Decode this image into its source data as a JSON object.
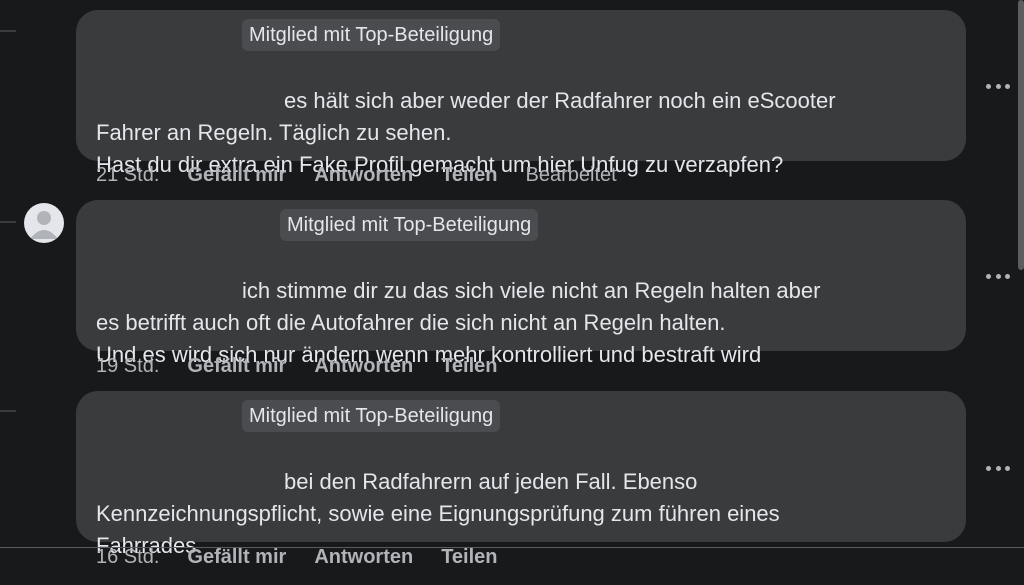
{
  "comments": [
    {
      "badge": "Mitglied mit Top-Beteiligung",
      "text": "es hält sich aber weder der Radfahrer noch ein eScooter\nFahrer an Regeln. Täglich zu sehen.\nHast du dir extra ein Fake Profil gemacht um hier Unfug zu verzapfen?",
      "time": "21 Std.",
      "like": "Gefällt mir",
      "reply": "Antworten",
      "share": "Teilen",
      "edited": "Bearbeitet"
    },
    {
      "badge": "Mitglied mit Top-Beteiligung",
      "text": "ich stimme dir zu das sich viele nicht an Regeln halten aber\nes betrifft auch oft die Autofahrer die sich nicht an Regeln halten.\nUnd es wird sich nur ändern wenn mehr kontrolliert und bestraft wird",
      "time": "19 Std.",
      "like": "Gefällt mir",
      "reply": "Antworten",
      "share": "Teilen"
    },
    {
      "badge": "Mitglied mit Top-Beteiligung",
      "text": "bei den Radfahrern auf jeden Fall. Ebenso\nKennzeichnungspflicht, sowie eine Eignungsprüfung zum führen eines\nFahrrades",
      "time": "16 Std.",
      "like": "Gefällt mir",
      "reply": "Antworten",
      "share": "Teilen"
    }
  ],
  "icons": {
    "more": "more-horizontal-icon",
    "avatar": "default-avatar-icon"
  }
}
